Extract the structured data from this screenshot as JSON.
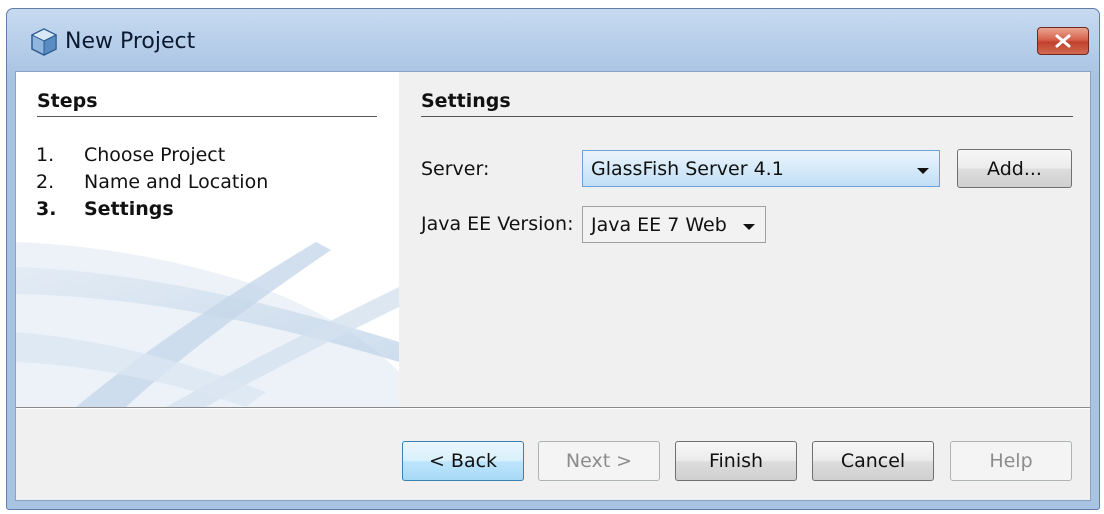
{
  "window": {
    "title": "New Project",
    "icon": "netbeans-cube-icon",
    "close_icon": "close-x-icon"
  },
  "steps": {
    "header": "Steps",
    "items": [
      {
        "num": "1.",
        "label": "Choose Project",
        "current": false
      },
      {
        "num": "2.",
        "label": "Name and Location",
        "current": false
      },
      {
        "num": "3.",
        "label": "Settings",
        "current": true
      }
    ]
  },
  "settings": {
    "header": "Settings",
    "server_label": "Server:",
    "server_value": "GlassFish Server 4.1",
    "add_button": "Add...",
    "javaee_label": "Java EE Version:",
    "javaee_value": "Java EE 7 Web"
  },
  "footer": {
    "back": "< Back",
    "next": "Next >",
    "finish": "Finish",
    "cancel": "Cancel",
    "help": "Help"
  },
  "colors": {
    "titlebar": "#b5cde9",
    "client_bg": "#f0f0f0",
    "close_button": "#c7503a",
    "focus_button": "#bee6fd"
  }
}
